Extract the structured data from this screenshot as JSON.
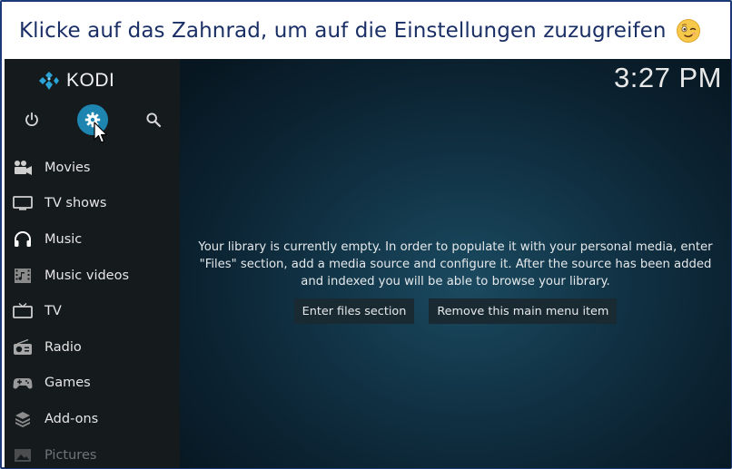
{
  "banner": {
    "text": "Klicke auf das Zahnrad, um auf die Einstellungen zuzugreifen",
    "emoji_icon": "winking-face-emoji"
  },
  "app": {
    "brand": "KODI",
    "clock": "3:27 PM",
    "top_icons": [
      "power-icon",
      "gear-icon",
      "search-icon"
    ],
    "active_icon": "gear-icon",
    "accent_color": "#1e84b0"
  },
  "sidebar": {
    "items": [
      {
        "label": "Movies",
        "icon": "movie-camera-icon"
      },
      {
        "label": "TV shows",
        "icon": "monitor-icon"
      },
      {
        "label": "Music",
        "icon": "headphones-icon"
      },
      {
        "label": "Music videos",
        "icon": "film-strip-icon"
      },
      {
        "label": "TV",
        "icon": "tv-icon"
      },
      {
        "label": "Radio",
        "icon": "radio-icon"
      },
      {
        "label": "Games",
        "icon": "gamepad-icon"
      },
      {
        "label": "Add-ons",
        "icon": "addons-box-icon"
      },
      {
        "label": "Pictures",
        "icon": "pictures-icon"
      }
    ]
  },
  "main": {
    "message": "Your library is currently empty. In order to populate it with your personal media, enter \"Files\" section, add a media source and configure it. After the source has been added and indexed you will be able to browse your library.",
    "enter_files_label": "Enter files section",
    "remove_item_label": "Remove this main menu item"
  }
}
